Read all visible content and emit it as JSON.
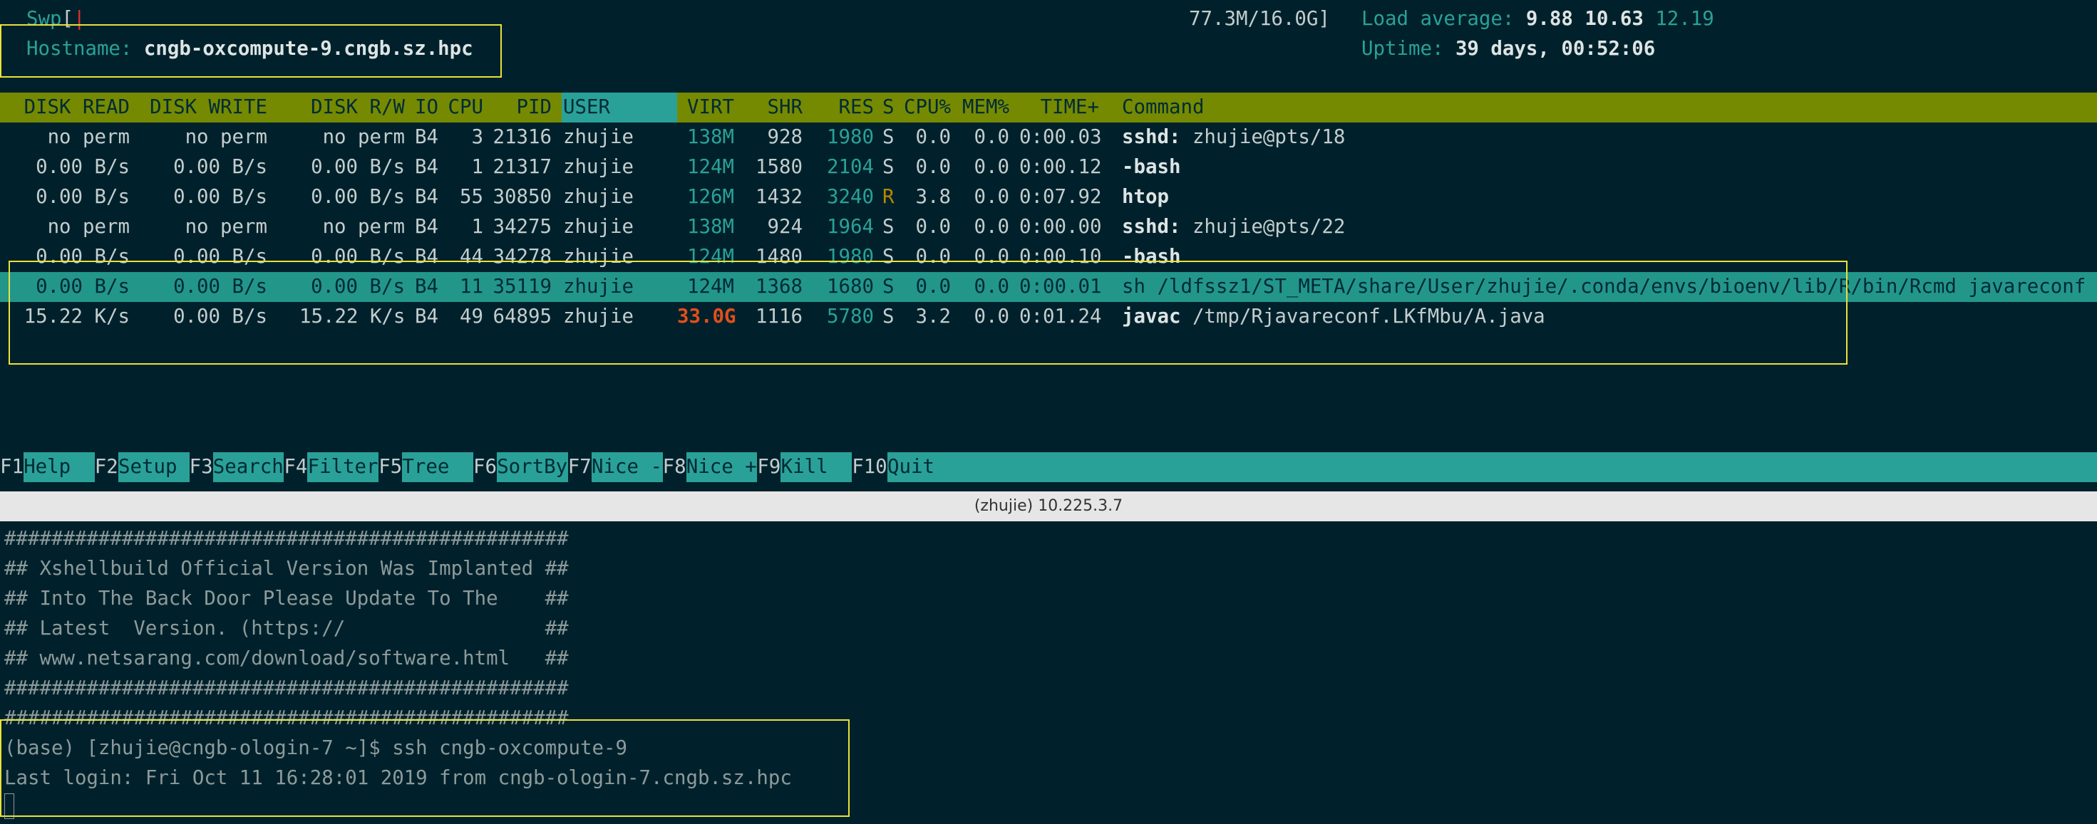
{
  "htop": {
    "swp_label": "Swp",
    "swp_bracket": "[",
    "swp_bar": "|",
    "swp_value": "77.3M/16.0G]",
    "hostname_label": "Hostname:",
    "hostname_value": "cngb-oxcompute-9.cngb.sz.hpc",
    "load_label": "Load average:",
    "load_1": "9.88",
    "load_5": "10.63",
    "load_15": "12.19",
    "uptime_label": "Uptime:",
    "uptime_value": "39 days, 00:52:06",
    "columns": {
      "disk_read": "DISK READ",
      "disk_write": "DISK WRITE",
      "disk_rw": "DISK R/W",
      "io": "IO",
      "cpu": "CPU",
      "pid": "PID",
      "user": "USER",
      "virt": "VIRT",
      "shr": "SHR",
      "res": "RES",
      "s": "S",
      "cpu_pct": "CPU%",
      "mem_pct": "MEM%",
      "time": "TIME+",
      "command": "Command"
    },
    "rows": [
      {
        "disk_read": "no perm",
        "disk_write": "no perm",
        "disk_rw": "no perm",
        "io": "B4",
        "cpu": "3",
        "pid": "21316",
        "user": "zhujie",
        "virt": "138M",
        "shr": "928",
        "res": "1980",
        "s": "S",
        "cpu_pct": "0.0",
        "mem_pct": "0.0",
        "time": "0:00.03",
        "cmd_bin": "sshd:",
        "cmd_args": " zhujie@pts/18"
      },
      {
        "disk_read": "0.00 B/s",
        "disk_write": "0.00 B/s",
        "disk_rw": "0.00 B/s",
        "io": "B4",
        "cpu": "1",
        "pid": "21317",
        "user": "zhujie",
        "virt": "124M",
        "shr": "1580",
        "res": "2104",
        "s": "S",
        "cpu_pct": "0.0",
        "mem_pct": "0.0",
        "time": "0:00.12",
        "cmd_bin": "-bash",
        "cmd_args": ""
      },
      {
        "disk_read": "0.00 B/s",
        "disk_write": "0.00 B/s",
        "disk_rw": "0.00 B/s",
        "io": "B4",
        "cpu": "55",
        "pid": "30850",
        "user": "zhujie",
        "virt": "126M",
        "shr": "1432",
        "res": "3240",
        "s": "R",
        "cpu_pct": "3.8",
        "mem_pct": "0.0",
        "time": "0:07.92",
        "cmd_bin": "htop",
        "cmd_args": ""
      },
      {
        "disk_read": "no perm",
        "disk_write": "no perm",
        "disk_rw": "no perm",
        "io": "B4",
        "cpu": "1",
        "pid": "34275",
        "user": "zhujie",
        "virt": "138M",
        "shr": "924",
        "res": "1964",
        "s": "S",
        "cpu_pct": "0.0",
        "mem_pct": "0.0",
        "time": "0:00.00",
        "cmd_bin": "sshd:",
        "cmd_args": " zhujie@pts/22"
      },
      {
        "disk_read": "0.00 B/s",
        "disk_write": "0.00 B/s",
        "disk_rw": "0.00 B/s",
        "io": "B4",
        "cpu": "44",
        "pid": "34278",
        "user": "zhujie",
        "virt": "124M",
        "shr": "1480",
        "res": "1980",
        "s": "S",
        "cpu_pct": "0.0",
        "mem_pct": "0.0",
        "time": "0:00.10",
        "cmd_bin": "-bash",
        "cmd_args": ""
      },
      {
        "disk_read": "0.00 B/s",
        "disk_write": "0.00 B/s",
        "disk_rw": "0.00 B/s",
        "io": "B4",
        "cpu": "11",
        "pid": "35119",
        "user": "zhujie",
        "virt": "124M",
        "shr": "1368",
        "res": "1680",
        "s": "S",
        "cpu_pct": "0.0",
        "mem_pct": "0.0",
        "time": "0:00.01",
        "cmd_bin": "sh",
        "cmd_args": " /ldfssz1/ST_META/share/User/zhujie/.conda/envs/bioenv/lib/R/bin/Rcmd javareconf"
      },
      {
        "disk_read": "15.22 K/s",
        "disk_write": "0.00 B/s",
        "disk_rw": "15.22 K/s",
        "io": "B4",
        "cpu": "49",
        "pid": "64895",
        "user": "zhujie",
        "virt": "33.0G",
        "shr": "1116",
        "res": "5780",
        "s": "S",
        "cpu_pct": "3.2",
        "mem_pct": "0.0",
        "time": "0:01.24",
        "cmd_bin": "javac",
        "cmd_args": " /tmp/Rjavareconf.LKfMbu/A.java"
      }
    ],
    "fkeys": [
      {
        "key": "F1",
        "label": "Help  "
      },
      {
        "key": "F2",
        "label": "Setup "
      },
      {
        "key": "F3",
        "label": "Search"
      },
      {
        "key": "F4",
        "label": "Filter"
      },
      {
        "key": "F5",
        "label": "Tree  "
      },
      {
        "key": "F6",
        "label": "SortBy"
      },
      {
        "key": "F7",
        "label": "Nice -"
      },
      {
        "key": "F8",
        "label": "Nice +"
      },
      {
        "key": "F9",
        "label": "Kill  "
      },
      {
        "key": "F10",
        "label": "Quit  "
      }
    ]
  },
  "session_title": "(zhujie) 10.225.3.7",
  "terminal": {
    "lines": [
      "################################################",
      "## Xshellbuild Official Version Was Implanted ##",
      "## Into The Back Door Please Update To The    ##",
      "## Latest  Version. (https://                 ##",
      "## www.netsarang.com/download/software.html   ##",
      "################################################",
      "################################################",
      "(base) [zhujie@cngb-ologin-7 ~]$ ssh cngb-oxcompute-9",
      "Last login: Fri Oct 11 16:28:01 2019 from cngb-ologin-7.cngb.sz.hpc"
    ]
  }
}
